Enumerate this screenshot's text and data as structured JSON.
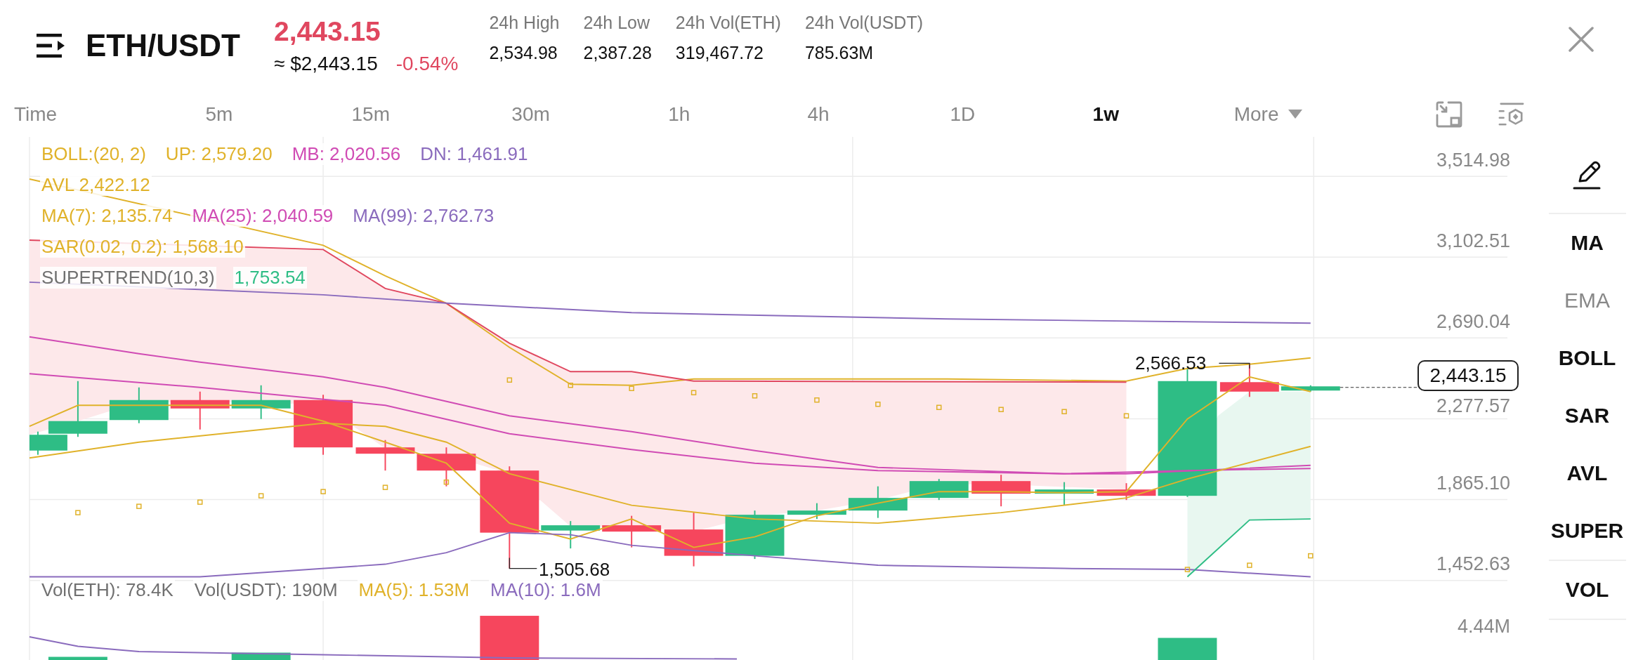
{
  "header": {
    "symbol": "ETH/USDT",
    "price": "2,443.15",
    "price_usd": "≈ $2,443.15",
    "change": "-0.54%",
    "stats": [
      {
        "label": "24h High",
        "value": "2,534.98"
      },
      {
        "label": "24h Low",
        "value": "2,387.28"
      },
      {
        "label": "24h Vol(ETH)",
        "value": "319,467.72"
      },
      {
        "label": "24h Vol(USDT)",
        "value": "785.63M"
      }
    ]
  },
  "intervals": [
    {
      "label": "Time",
      "selected": false,
      "kind": "tab"
    },
    {
      "label": "5m",
      "selected": false,
      "kind": "tab"
    },
    {
      "label": "15m",
      "selected": false,
      "kind": "tab"
    },
    {
      "label": "30m",
      "selected": false,
      "kind": "tab"
    },
    {
      "label": "1h",
      "selected": false,
      "kind": "tab"
    },
    {
      "label": "4h",
      "selected": false,
      "kind": "tab"
    },
    {
      "label": "1D",
      "selected": false,
      "kind": "tab"
    },
    {
      "label": "1w",
      "selected": true,
      "kind": "tab"
    },
    {
      "label": "More",
      "selected": false,
      "kind": "dropdown"
    }
  ],
  "chart": {
    "legend": [
      [
        {
          "text": "BOLL:(20, 2)",
          "color": "#e0b22a"
        },
        {
          "text": "UP: 2,579.20",
          "color": "#e0b22a"
        },
        {
          "text": "MB: 2,020.56",
          "color": "#d04bb4"
        },
        {
          "text": "DN: 1,461.91",
          "color": "#8a6bbd"
        }
      ],
      [
        {
          "text": "AVL 2,422.12",
          "color": "#e0b22a"
        }
      ],
      [
        {
          "text": "MA(7): 2,135.74",
          "color": "#e0b22a"
        },
        {
          "text": "MA(25): 2,040.59",
          "color": "#d04bb4"
        },
        {
          "text": "MA(99): 2,762.73",
          "color": "#8a6bbd"
        }
      ],
      [
        {
          "text": "SAR(0.02, 0.2): 1,568.10",
          "color": "#e0b22a"
        }
      ],
      [
        {
          "text": "SUPERTREND(10,3)",
          "color": "#707070"
        },
        {
          "text": "1,753.54",
          "color": "#2ebd85"
        }
      ]
    ],
    "price_axis": [
      "3,514.98",
      "3,102.51",
      "2,690.04",
      "2,277.57",
      "1,865.10",
      "1,452.63"
    ],
    "high_marker": "2,566.53",
    "low_marker": "1,505.68",
    "last_price": "2,443.15",
    "volume_legend": [
      {
        "text": "Vol(ETH): 78.4K",
        "color": "#707070"
      },
      {
        "text": "Vol(USDT): 190M",
        "color": "#707070"
      },
      {
        "text": "MA(5): 1.53M",
        "color": "#e0b22a"
      },
      {
        "text": "MA(10): 1.6M",
        "color": "#8a6bbd"
      }
    ],
    "volume_axis": [
      "4.44M"
    ]
  },
  "indicators": [
    {
      "label": "MA",
      "enabled": true
    },
    {
      "label": "EMA",
      "enabled": false
    },
    {
      "label": "BOLL",
      "enabled": true
    },
    {
      "label": "SAR",
      "enabled": true
    },
    {
      "label": "AVL",
      "enabled": true
    },
    {
      "label": "SUPER",
      "enabled": true
    },
    {
      "label": "VOL",
      "enabled": true
    }
  ]
}
